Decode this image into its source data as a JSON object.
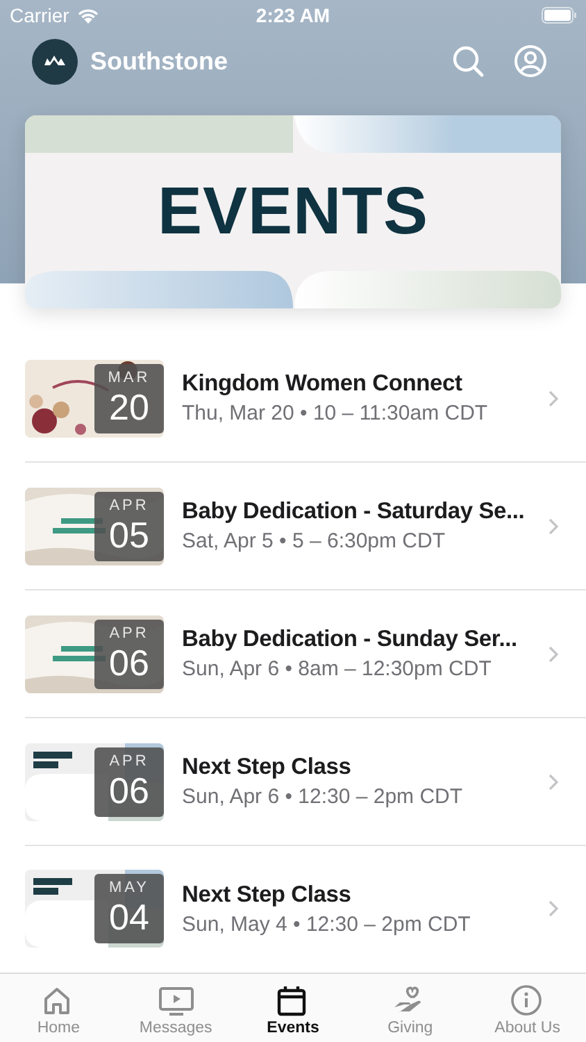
{
  "status_bar": {
    "carrier": "Carrier",
    "time": "2:23 AM"
  },
  "header": {
    "title": "Southstone"
  },
  "banner": {
    "title": "EVENTS"
  },
  "events": [
    {
      "title": "Kingdom Women Connect",
      "when": "Thu, Mar 20 • 10 – 11:30am CDT",
      "month": "MAR",
      "day": "20"
    },
    {
      "title": "Baby Dedication - Saturday Se...",
      "when": "Sat, Apr 5 • 5 – 6:30pm CDT",
      "month": "APR",
      "day": "05"
    },
    {
      "title": "Baby Dedication - Sunday Ser...",
      "when": "Sun, Apr 6 • 8am – 12:30pm CDT",
      "month": "APR",
      "day": "06"
    },
    {
      "title": "Next Step Class",
      "when": "Sun, Apr 6 • 12:30 – 2pm CDT",
      "month": "APR",
      "day": "06"
    },
    {
      "title": "Next Step Class",
      "when": "Sun, May 4 • 12:30 – 2pm CDT",
      "month": "MAY",
      "day": "04"
    }
  ],
  "tabs": [
    {
      "label": "Home",
      "selected": false
    },
    {
      "label": "Messages",
      "selected": false
    },
    {
      "label": "Events",
      "selected": true
    },
    {
      "label": "Giving",
      "selected": false
    },
    {
      "label": "About Us",
      "selected": false
    }
  ]
}
